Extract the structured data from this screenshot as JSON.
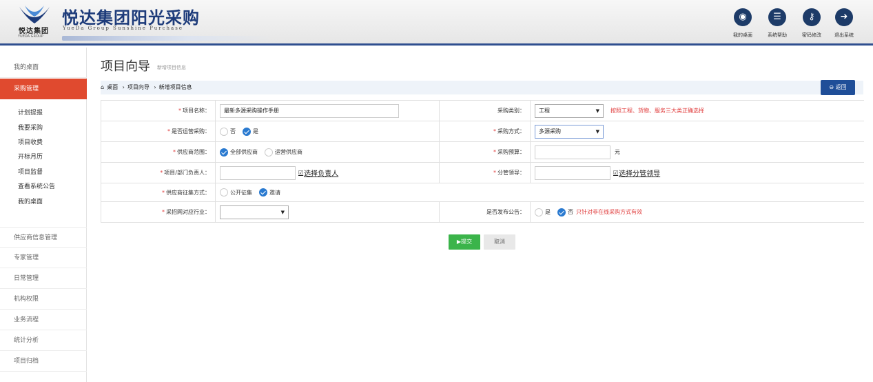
{
  "header": {
    "brand_cn": "悦达集团",
    "brand_en": "YUEDA GROUP",
    "title": "悦达集团阳光采购",
    "subtitle": "YueDa Group Sunshine Purchase",
    "buttons": [
      {
        "label": "我的桌面",
        "icon": "globe-icon"
      },
      {
        "label": "系统帮助",
        "icon": "document-icon"
      },
      {
        "label": "密码修改",
        "icon": "key-icon"
      },
      {
        "label": "退出系统",
        "icon": "logout-icon"
      }
    ]
  },
  "sidebar": {
    "items": [
      {
        "label": "我的桌面"
      },
      {
        "label": "采购管理"
      },
      {
        "label": "计划提报"
      },
      {
        "label": "我要采购"
      },
      {
        "label": "项目收费"
      },
      {
        "label": "开标月历"
      },
      {
        "label": "项目监督"
      },
      {
        "label": "查看系统公告"
      },
      {
        "label": "我的桌面"
      },
      {
        "label": "供应商信息管理"
      },
      {
        "label": "专家管理"
      },
      {
        "label": "日常管理"
      },
      {
        "label": "机构权限"
      },
      {
        "label": "业务流程"
      },
      {
        "label": "统计分析"
      },
      {
        "label": "项目归档"
      }
    ]
  },
  "page": {
    "title": "项目向导",
    "subtitle": "新增项目信息",
    "breadcrumb": [
      "桌面",
      "项目向导",
      "新增项目信息"
    ],
    "back_label": "返回"
  },
  "form": {
    "project_name": {
      "label": "项目名称：",
      "value": "最新多源采购操作手册"
    },
    "purchase_category": {
      "label": "采购类别：",
      "value": "工程",
      "hint": "按照工程、货物、服务三大类正确选择"
    },
    "is_operation": {
      "label": "是否运营采购：",
      "options": [
        "否",
        "是"
      ],
      "selected": "是"
    },
    "purchase_method": {
      "label": "采购方式：",
      "value": "多源采购"
    },
    "supplier_scope": {
      "label": "供应商范围：",
      "options": [
        "全部供应商",
        "运营供应商"
      ],
      "selected": "全部供应商"
    },
    "budget": {
      "label": "采购预算：",
      "value": "",
      "unit": "元"
    },
    "project_owner": {
      "label": "项目/部门负责人：",
      "value": "",
      "link": "选择负责人"
    },
    "supervisor": {
      "label": "分管领导：",
      "value": "",
      "link": "选择分管领导"
    },
    "supplier_collect": {
      "label": "供应商征集方式：",
      "options": [
        "公开征集",
        "邀请"
      ],
      "selected": "邀请"
    },
    "industry": {
      "label": "采招网对应行业：",
      "value": ""
    },
    "publish_notice": {
      "label": "是否发布公告：",
      "options": [
        "是",
        "否"
      ],
      "selected": "否",
      "hint": "只针对非在线采购方式有效"
    }
  },
  "actions": {
    "submit_label": "提交",
    "cancel_label": "取消"
  },
  "colors": {
    "accent": "#e04a2f",
    "primary": "#1f4e98",
    "success": "#3bb44a",
    "danger": "#e03c3c"
  }
}
